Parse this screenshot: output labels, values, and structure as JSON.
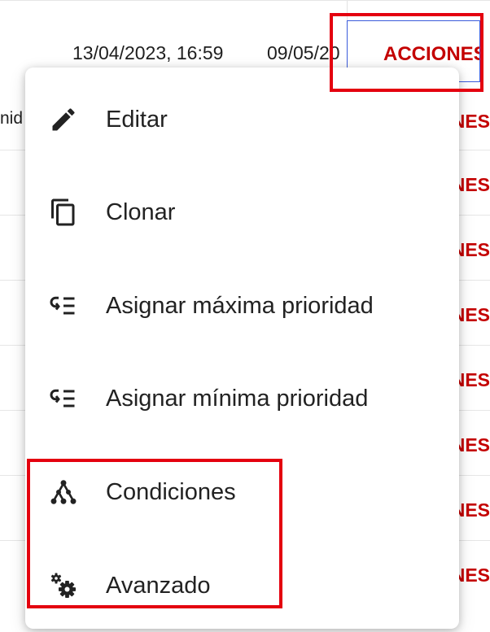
{
  "table": {
    "date_created": "13/04/2023, 16:59",
    "date_second": "09/05/20",
    "partial_cell": "nid",
    "actions_header": "ACCIONES",
    "actions_cell": "ACCIONES"
  },
  "menu": {
    "items": [
      {
        "label": "Editar",
        "icon": "pencil-icon"
      },
      {
        "label": "Clonar",
        "icon": "copy-icon"
      },
      {
        "label": "Asignar máxima prioridad",
        "icon": "priority-list-icon"
      },
      {
        "label": "Asignar mínima prioridad",
        "icon": "priority-list-icon"
      },
      {
        "label": "Condiciones",
        "icon": "tree-nodes-icon"
      },
      {
        "label": "Avanzado",
        "icon": "gears-icon"
      }
    ]
  },
  "colors": {
    "highlight": "#e4000f",
    "accent_text": "#c40000",
    "focus_border": "#3b5bdb"
  }
}
